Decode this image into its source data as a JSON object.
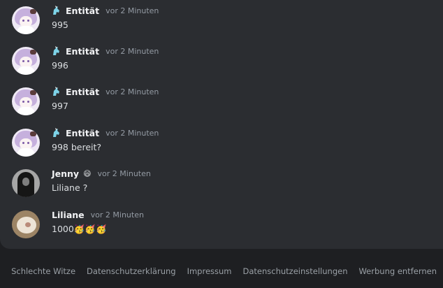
{
  "messages": [
    {
      "author": "Entität",
      "time": "vor 2 Minuten",
      "text": "995"
    },
    {
      "author": "Entität",
      "time": "vor 2 Minuten",
      "text": "996"
    },
    {
      "author": "Entität",
      "time": "vor 2 Minuten",
      "text": "997"
    },
    {
      "author": "Entität",
      "time": "vor 2 Minuten",
      "text": "998 bereit?"
    },
    {
      "author": "Jenny",
      "author_emoji": "😄",
      "time": "vor 2 Minuten",
      "text": "Liliane ?"
    },
    {
      "author": "Liliane",
      "time": "vor 2 Minuten",
      "text": "1000🥳🥳🥳"
    }
  ],
  "footer": {
    "links": [
      "Schlechte Witze",
      "Datenschutzerklärung",
      "Impressum",
      "Datenschutzeinstellungen",
      "Werbung entfernen"
    ]
  },
  "colors": {
    "chat_bg": "#2b2d31",
    "page_bg": "#1e1f22",
    "timestamp": "#949ba4",
    "role_icon": "#7dd3e8"
  },
  "icons": {
    "role_badge": "unicorn-icon"
  }
}
